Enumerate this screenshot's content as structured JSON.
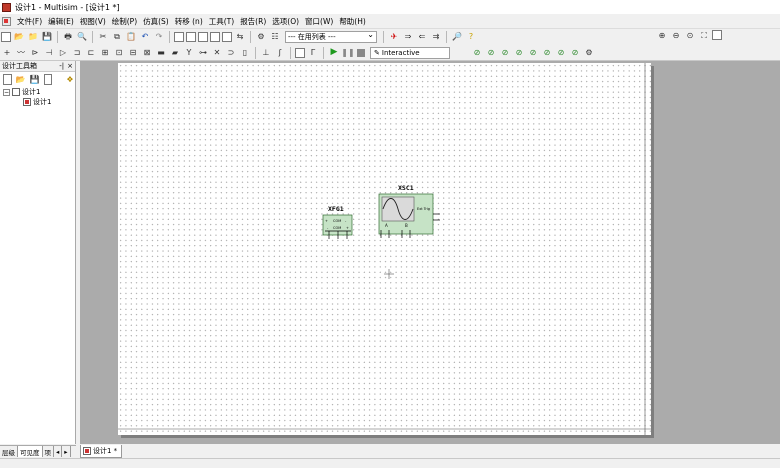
{
  "window": {
    "title": "设计1 - Multisim - [设计1 *]"
  },
  "menu": [
    "文件(F)",
    "编辑(E)",
    "视图(V)",
    "绘制(P)",
    "仿真(S)",
    "转移 (n)",
    "工具(T)",
    "报告(R)",
    "选项(O)",
    "窗口(W)",
    "帮助(H)"
  ],
  "toolbar": {
    "in_use_list": "--- 在用列表 ---",
    "interactive_label": "Interactive"
  },
  "design_toolbox": {
    "title": "设计工具箱",
    "pin_label": "-|",
    "close_label": "×",
    "tree_root": "设计1",
    "tree_child": "设计1",
    "tabs": [
      "层级",
      "可见度",
      "项"
    ]
  },
  "schematic": {
    "xfg": {
      "ref": "XFG1",
      "terminals": [
        "+",
        "COM",
        "-"
      ],
      "pin_labels": [
        "-",
        "COM",
        "+"
      ]
    },
    "xsc": {
      "ref": "XSC1",
      "ext_trig": "Ext Trig",
      "ch_a": "A",
      "ch_b": "B"
    }
  },
  "document_tab": {
    "label": "设计1 *"
  },
  "colors": {
    "instrument_fill": "#c6e3c6",
    "instrument_border": "#2f6b2f",
    "sheet": "#ffffff",
    "workspace": "#ababab"
  }
}
